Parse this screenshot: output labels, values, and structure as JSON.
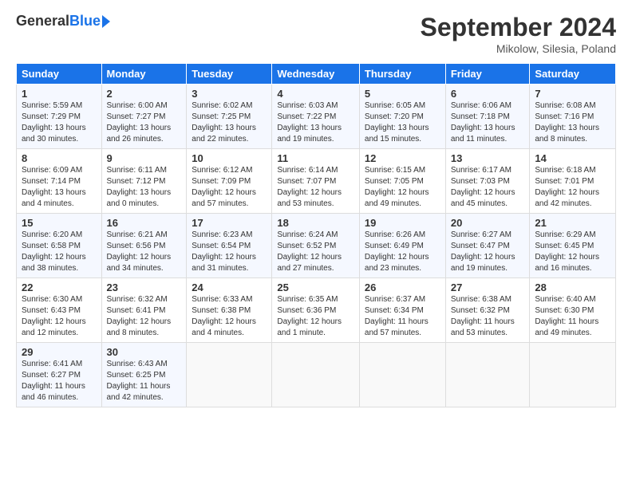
{
  "header": {
    "logo_general": "General",
    "logo_blue": "Blue",
    "month_title": "September 2024",
    "location": "Mikolow, Silesia, Poland"
  },
  "days_of_week": [
    "Sunday",
    "Monday",
    "Tuesday",
    "Wednesday",
    "Thursday",
    "Friday",
    "Saturday"
  ],
  "weeks": [
    [
      {
        "day": "1",
        "sunrise": "5:59 AM",
        "sunset": "7:29 PM",
        "daylight": "13 hours and 30 minutes."
      },
      {
        "day": "2",
        "sunrise": "6:00 AM",
        "sunset": "7:27 PM",
        "daylight": "13 hours and 26 minutes."
      },
      {
        "day": "3",
        "sunrise": "6:02 AM",
        "sunset": "7:25 PM",
        "daylight": "13 hours and 22 minutes."
      },
      {
        "day": "4",
        "sunrise": "6:03 AM",
        "sunset": "7:22 PM",
        "daylight": "13 hours and 19 minutes."
      },
      {
        "day": "5",
        "sunrise": "6:05 AM",
        "sunset": "7:20 PM",
        "daylight": "13 hours and 15 minutes."
      },
      {
        "day": "6",
        "sunrise": "6:06 AM",
        "sunset": "7:18 PM",
        "daylight": "13 hours and 11 minutes."
      },
      {
        "day": "7",
        "sunrise": "6:08 AM",
        "sunset": "7:16 PM",
        "daylight": "13 hours and 8 minutes."
      }
    ],
    [
      {
        "day": "8",
        "sunrise": "6:09 AM",
        "sunset": "7:14 PM",
        "daylight": "13 hours and 4 minutes."
      },
      {
        "day": "9",
        "sunrise": "6:11 AM",
        "sunset": "7:12 PM",
        "daylight": "13 hours and 0 minutes."
      },
      {
        "day": "10",
        "sunrise": "6:12 AM",
        "sunset": "7:09 PM",
        "daylight": "12 hours and 57 minutes."
      },
      {
        "day": "11",
        "sunrise": "6:14 AM",
        "sunset": "7:07 PM",
        "daylight": "12 hours and 53 minutes."
      },
      {
        "day": "12",
        "sunrise": "6:15 AM",
        "sunset": "7:05 PM",
        "daylight": "12 hours and 49 minutes."
      },
      {
        "day": "13",
        "sunrise": "6:17 AM",
        "sunset": "7:03 PM",
        "daylight": "12 hours and 45 minutes."
      },
      {
        "day": "14",
        "sunrise": "6:18 AM",
        "sunset": "7:01 PM",
        "daylight": "12 hours and 42 minutes."
      }
    ],
    [
      {
        "day": "15",
        "sunrise": "6:20 AM",
        "sunset": "6:58 PM",
        "daylight": "12 hours and 38 minutes."
      },
      {
        "day": "16",
        "sunrise": "6:21 AM",
        "sunset": "6:56 PM",
        "daylight": "12 hours and 34 minutes."
      },
      {
        "day": "17",
        "sunrise": "6:23 AM",
        "sunset": "6:54 PM",
        "daylight": "12 hours and 31 minutes."
      },
      {
        "day": "18",
        "sunrise": "6:24 AM",
        "sunset": "6:52 PM",
        "daylight": "12 hours and 27 minutes."
      },
      {
        "day": "19",
        "sunrise": "6:26 AM",
        "sunset": "6:49 PM",
        "daylight": "12 hours and 23 minutes."
      },
      {
        "day": "20",
        "sunrise": "6:27 AM",
        "sunset": "6:47 PM",
        "daylight": "12 hours and 19 minutes."
      },
      {
        "day": "21",
        "sunrise": "6:29 AM",
        "sunset": "6:45 PM",
        "daylight": "12 hours and 16 minutes."
      }
    ],
    [
      {
        "day": "22",
        "sunrise": "6:30 AM",
        "sunset": "6:43 PM",
        "daylight": "12 hours and 12 minutes."
      },
      {
        "day": "23",
        "sunrise": "6:32 AM",
        "sunset": "6:41 PM",
        "daylight": "12 hours and 8 minutes."
      },
      {
        "day": "24",
        "sunrise": "6:33 AM",
        "sunset": "6:38 PM",
        "daylight": "12 hours and 4 minutes."
      },
      {
        "day": "25",
        "sunrise": "6:35 AM",
        "sunset": "6:36 PM",
        "daylight": "12 hours and 1 minute."
      },
      {
        "day": "26",
        "sunrise": "6:37 AM",
        "sunset": "6:34 PM",
        "daylight": "11 hours and 57 minutes."
      },
      {
        "day": "27",
        "sunrise": "6:38 AM",
        "sunset": "6:32 PM",
        "daylight": "11 hours and 53 minutes."
      },
      {
        "day": "28",
        "sunrise": "6:40 AM",
        "sunset": "6:30 PM",
        "daylight": "11 hours and 49 minutes."
      }
    ],
    [
      {
        "day": "29",
        "sunrise": "6:41 AM",
        "sunset": "6:27 PM",
        "daylight": "11 hours and 46 minutes."
      },
      {
        "day": "30",
        "sunrise": "6:43 AM",
        "sunset": "6:25 PM",
        "daylight": "11 hours and 42 minutes."
      },
      null,
      null,
      null,
      null,
      null
    ]
  ]
}
